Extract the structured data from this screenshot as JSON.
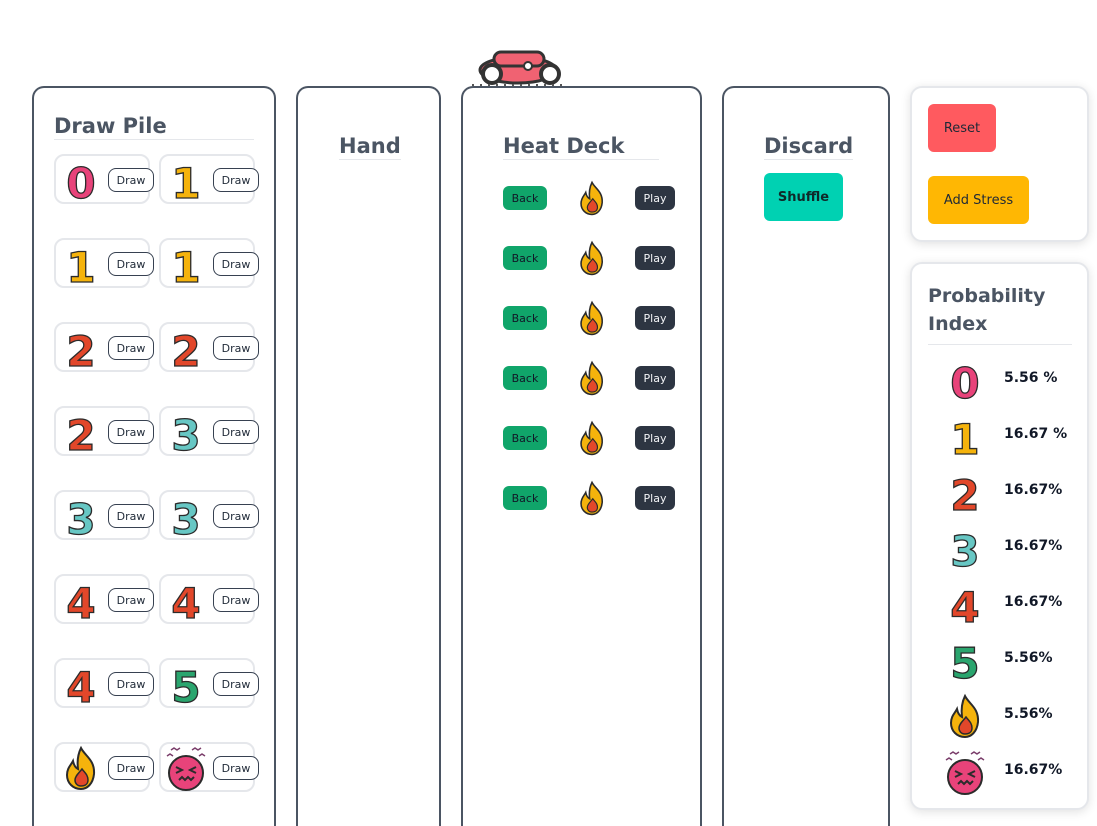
{
  "draw_pile": {
    "title": "Draw Pile",
    "cards": [
      {
        "symbol": "0",
        "color": "#e8437a",
        "draw_label": "Draw"
      },
      {
        "symbol": "1",
        "color": "#f5b30c",
        "draw_label": "Draw"
      },
      {
        "symbol": "1",
        "color": "#f5b30c",
        "draw_label": "Draw"
      },
      {
        "symbol": "1",
        "color": "#f5b30c",
        "draw_label": "Draw"
      },
      {
        "symbol": "2",
        "color": "#e2472a",
        "draw_label": "Draw"
      },
      {
        "symbol": "2",
        "color": "#e2472a",
        "draw_label": "Draw"
      },
      {
        "symbol": "2",
        "color": "#e2472a",
        "draw_label": "Draw"
      },
      {
        "symbol": "3",
        "color": "#67c7c4",
        "draw_label": "Draw"
      },
      {
        "symbol": "3",
        "color": "#67c7c4",
        "draw_label": "Draw"
      },
      {
        "symbol": "3",
        "color": "#67c7c4",
        "draw_label": "Draw"
      },
      {
        "symbol": "4",
        "color": "#e2472a",
        "draw_label": "Draw"
      },
      {
        "symbol": "4",
        "color": "#e2472a",
        "draw_label": "Draw"
      },
      {
        "symbol": "4",
        "color": "#e2472a",
        "draw_label": "Draw"
      },
      {
        "symbol": "5",
        "color": "#2aa56e",
        "draw_label": "Draw"
      },
      {
        "symbol": "heat",
        "icon": "flame-icon",
        "draw_label": "Draw"
      },
      {
        "symbol": "stress",
        "icon": "stressed-face-icon",
        "draw_label": "Draw"
      }
    ]
  },
  "hand": {
    "title": "Hand"
  },
  "heat_deck": {
    "title": "Heat Deck",
    "cards": [
      {
        "icon": "flame-icon",
        "back_label": "Back",
        "play_label": "Play"
      },
      {
        "icon": "flame-icon",
        "back_label": "Back",
        "play_label": "Play"
      },
      {
        "icon": "flame-icon",
        "back_label": "Back",
        "play_label": "Play"
      },
      {
        "icon": "flame-icon",
        "back_label": "Back",
        "play_label": "Play"
      },
      {
        "icon": "flame-icon",
        "back_label": "Back",
        "play_label": "Play"
      },
      {
        "icon": "flame-icon",
        "back_label": "Back",
        "play_label": "Play"
      }
    ]
  },
  "discard": {
    "title": "Discard",
    "shuffle_label": "Shuffle"
  },
  "controls": {
    "reset_label": "Reset",
    "add_stress_label": "Add Stress"
  },
  "probability": {
    "title": "Probability Index",
    "rows": [
      {
        "symbol": "0",
        "color": "#e8437a",
        "value": "5.56 %"
      },
      {
        "symbol": "1",
        "color": "#f5b30c",
        "value": "16.67 %"
      },
      {
        "symbol": "2",
        "color": "#e2472a",
        "value": "16.67%"
      },
      {
        "symbol": "3",
        "color": "#67c7c4",
        "value": "16.67%"
      },
      {
        "symbol": "4",
        "color": "#e2472a",
        "value": "16.67%"
      },
      {
        "symbol": "5",
        "color": "#2aa56e",
        "value": "5.56%"
      },
      {
        "symbol": "heat",
        "icon": "flame-icon",
        "value": "5.56%"
      },
      {
        "symbol": "stress",
        "icon": "stressed-face-icon",
        "value": "16.67%"
      }
    ]
  },
  "header": {
    "logo_icon": "race-car-icon"
  },
  "colors": {
    "reset": "#ff5a5f",
    "add_stress": "#ffb703",
    "shuffle": "#00d1b2",
    "back": "#10a56a",
    "play": "#2d3542",
    "panel_border": "#4b5563",
    "title": "#4b5563"
  }
}
